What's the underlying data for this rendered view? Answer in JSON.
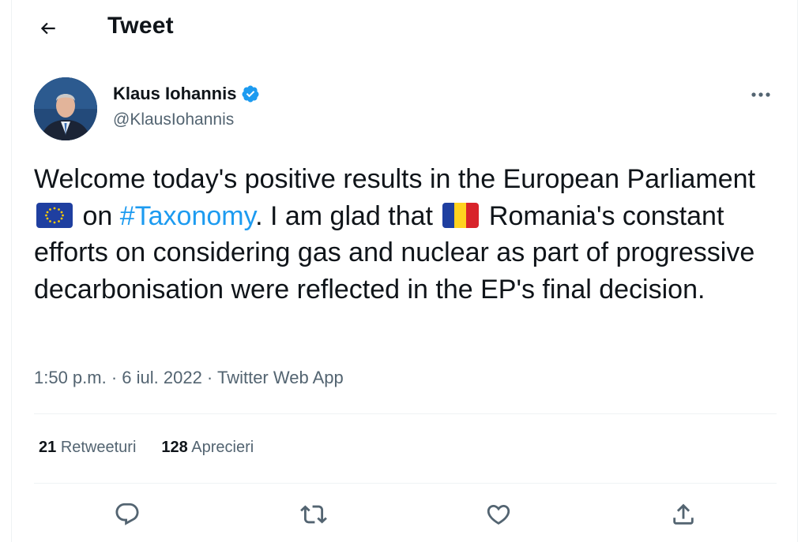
{
  "header": {
    "title": "Tweet",
    "back_icon": "arrow-left-icon"
  },
  "author": {
    "display_name": "Klaus Iohannis",
    "handle": "@KlausIohannis",
    "verified_icon": "verified-badge-icon"
  },
  "tweet": {
    "text_part1": "Welcome today's positive results in the European Parliament ",
    "text_part2": " on ",
    "hashtag": "#Taxonomy",
    "text_part3": ". I am glad that ",
    "text_part4": " Romania's constant efforts on considering gas and nuclear as part of progressive decarbonisation were reflected in the EP's final decision.",
    "emoji_1": "eu-flag-icon",
    "emoji_2": "romania-flag-icon"
  },
  "meta": {
    "time": "1:50 p.m.",
    "separator": " · ",
    "date": "6 iul. 2022",
    "source": "Twitter Web App"
  },
  "stats": {
    "retweets_count": "21",
    "retweets_label": "Retweeturi",
    "likes_count": "128",
    "likes_label": "Aprecieri"
  },
  "actions": [
    "reply-icon",
    "retweet-icon",
    "like-icon",
    "share-icon"
  ],
  "colors": {
    "accent": "#1d9bf0",
    "text": "#0f1419",
    "secondary": "#536471",
    "divider": "#eff3f4"
  }
}
